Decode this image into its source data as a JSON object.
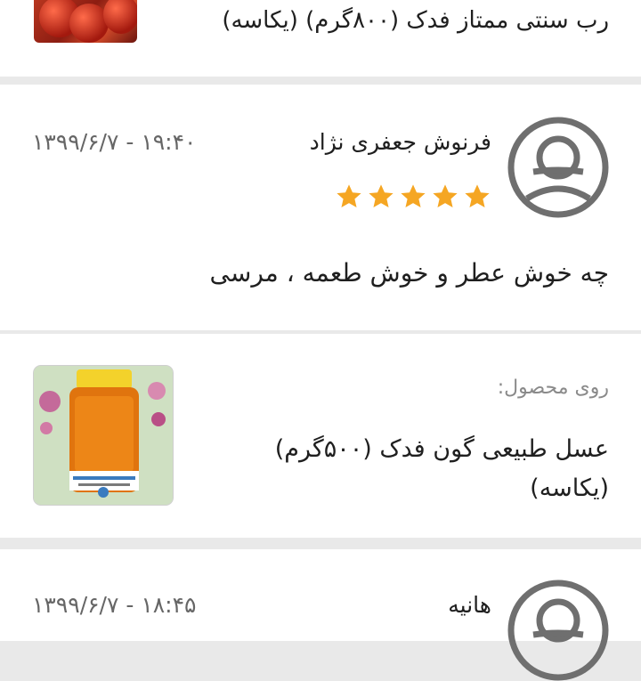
{
  "top_product": {
    "title": "رب سنتی ممتاز فدک (۸۰۰گرم) (یکاسه)"
  },
  "reviews": [
    {
      "author": "فرنوش جعفری نژاد",
      "datetime": "۱۳۹۹/۶/۷ - ۱۹:۴۰",
      "rating": 5,
      "comment": "چه خوش عطر و خوش طعمه ، مرسی",
      "avatar_icon": "user-avatar-icon"
    },
    {
      "author": "هانیه",
      "datetime": "۱۳۹۹/۶/۷ - ۱۸:۴۵",
      "avatar_icon": "user-avatar-icon"
    }
  ],
  "product_ref": {
    "label": "روی محصول:",
    "title": "عسل طبیعی گون فدک (۵۰۰گرم) (یکاسه)"
  },
  "colors": {
    "star": "#f5a623",
    "avatar_stroke": "#6f6f6f",
    "divider_bg": "#e9e9e9",
    "muted_text": "#8a8a8a"
  }
}
